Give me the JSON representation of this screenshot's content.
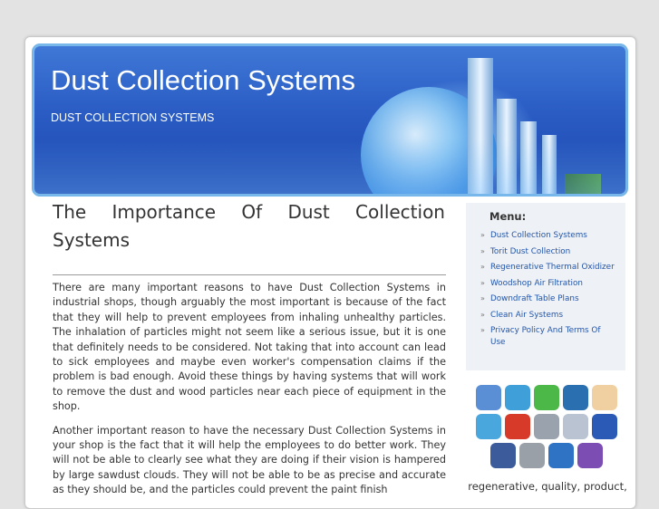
{
  "header": {
    "title": "Dust Collection Systems",
    "tagline": "DUST COLLECTION SYSTEMS"
  },
  "article": {
    "title_line1": "The Importance Of Dust Collection",
    "title_line2": "Systems",
    "paragraphs": [
      "There are many important reasons to have Dust Collection Systems in industrial shops, though arguably the most important is because of the fact that they will help to prevent employees from inhaling unhealthy particles. The inhalation of particles might not seem like a serious issue, but it is one that definitely needs to be considered. Not taking that into account can lead to sick employees and maybe even worker's compensation claims if the problem is bad enough. Avoid these things by having systems that will work to remove the dust and wood particles near each piece of equipment in the shop.",
      "Another important reason to have the necessary Dust Collection Systems in your shop is the fact that it will help the employees to do better work. They will not be able to clearly see what they are doing if their vision is hampered by large sawdust clouds. They will not be able to be as precise and accurate as they should be, and the particles could prevent the paint finish"
    ]
  },
  "sidebar": {
    "menu_title": "Menu:",
    "items": [
      {
        "label": "Dust Collection Systems"
      },
      {
        "label": "Torit Dust Collection"
      },
      {
        "label": "Regenerative Thermal Oxidizer"
      },
      {
        "label": "Woodshop Air Filtration"
      },
      {
        "label": "Downdraft Table Plans"
      },
      {
        "label": "Clean Air Systems"
      },
      {
        "label": "Privacy Policy And Terms Of Use"
      }
    ],
    "social": [
      [
        {
          "icon": "bookmark-globe-icon",
          "glyph": "",
          "color": "#5a8fd6"
        },
        {
          "icon": "stumbleupon-icon",
          "glyph": "su",
          "color": "#3f9fd8"
        },
        {
          "icon": "chat-bubble-icon",
          "glyph": "",
          "color": "#4cb848"
        },
        {
          "icon": "linkedin-icon",
          "glyph": "in",
          "color": "#2a6fb0"
        },
        {
          "icon": "blogger-icon",
          "glyph": "G",
          "color": "#f0d0a0"
        }
      ],
      [
        {
          "icon": "twitter-icon",
          "glyph": "t",
          "color": "#4aa7dd"
        },
        {
          "icon": "mixx-icon",
          "glyph": "",
          "color": "#d83a2a"
        },
        {
          "icon": "reddit-icon",
          "glyph": "",
          "color": "#9aa3ad"
        },
        {
          "icon": "google-icon",
          "glyph": "G",
          "color": "#b9c3d1"
        },
        {
          "icon": "delicious-icon",
          "glyph": "",
          "color": "#2a5ab5"
        }
      ],
      [
        {
          "icon": "facebook-icon",
          "glyph": "f",
          "color": "#3b5b9b"
        },
        {
          "icon": "diigo-icon",
          "glyph": "",
          "color": "#9aa0a8"
        },
        {
          "icon": "myspace-icon",
          "glyph": "",
          "color": "#2f73c4"
        },
        {
          "icon": "buzz-icon",
          "glyph": "b",
          "color": "#7c4db3"
        }
      ]
    ],
    "footer_text": "regenerative, quality, product,"
  }
}
